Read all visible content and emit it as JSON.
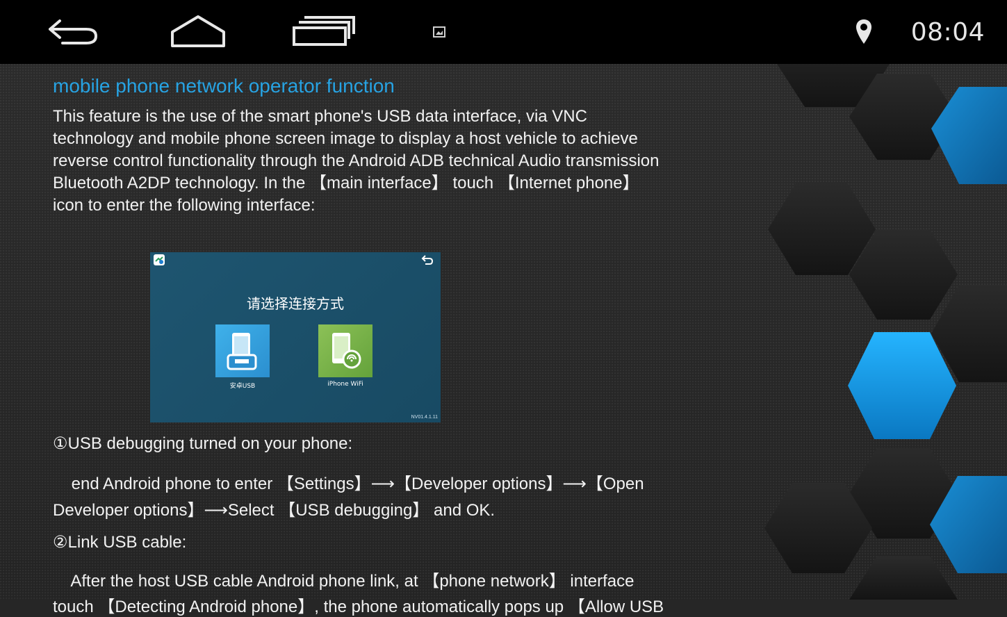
{
  "status_bar": {
    "time": "08:04",
    "icons": [
      "back-icon",
      "home-icon",
      "recent-apps-icon",
      "screenshot-notification-icon",
      "location-icon"
    ]
  },
  "content": {
    "title": "mobile phone network operator function",
    "intro_lines": [
      "This feature is the use of the smart phone's USB data interface, via VNC",
      "technology and mobile phone screen image to display a host vehicle to achieve",
      "reverse control functionality through the Android ADB technical Audio transmission",
      "Bluetooth A2DP technology. In the 【main interface】 touch 【Internet phone】",
      "icon to enter the following interface:"
    ],
    "embedded_screen": {
      "heading": "请选择连接方式",
      "options": [
        {
          "label": "安卓USB",
          "icon": "android-usb-icon"
        },
        {
          "label": "iPhone WiFi",
          "icon": "iphone-wifi-icon"
        }
      ],
      "version": "NV01.4.1.11",
      "icons": [
        "app-logo-icon",
        "back-arrow-icon"
      ]
    },
    "step1_title": "①USB debugging turned on your phone:",
    "step1_lines": [
      "    end Android phone to enter 【Settings】⟶【Developer options】⟶【Open",
      "Developer options】⟶Select 【USB debugging】 and OK."
    ],
    "step2_title": "②Link USB cable:",
    "step2_lines": [
      "    After the host USB cable Android phone link, at 【phone network】 interface",
      "touch 【Detecting Android phone】, the phone automatically pops up 【Allow USB"
    ]
  },
  "colors": {
    "title": "#27a3e3",
    "status_bar": "#000000",
    "hex_blue": "#1597e5",
    "embedded_bg": "#1e5570"
  }
}
